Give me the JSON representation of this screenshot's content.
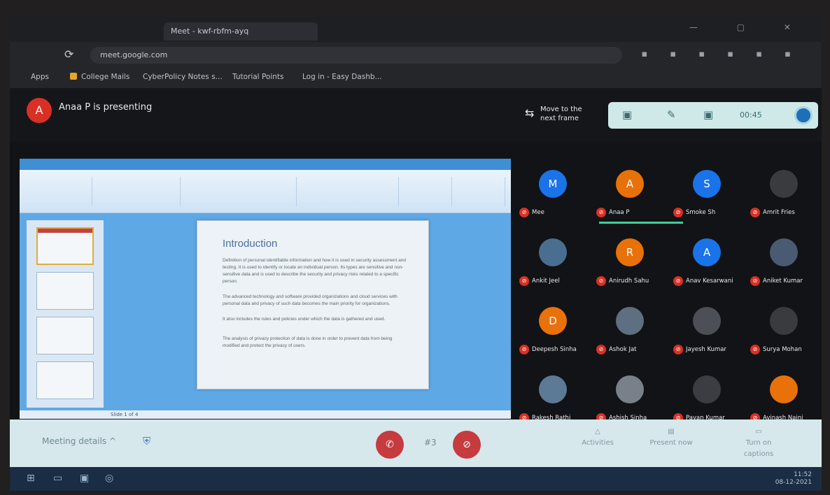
{
  "browser": {
    "tab_title": "Meet - kwf-rbfm-ayq",
    "url": "meet.google.com",
    "bookmarks": [
      "Apps",
      "College Mails",
      "CyberPolicy Notes s...",
      "Tutorial Points",
      "Log in - Easy Dashb..."
    ],
    "window_controls": "— ▢ ✕",
    "extensions": "▪ ▪ ▪ ▪ ▪ ▪"
  },
  "meet": {
    "presenter_initial": "A",
    "presenting_text": "Anaa P is presenting",
    "presenting_sub": "",
    "move_label_1": "Move to the",
    "move_label_2": "next frame",
    "control_icons": [
      "▣",
      "✎",
      "▣",
      "00:45",
      "●"
    ],
    "meeting_details_label": "Meeting details",
    "meeting_details_caret": "^",
    "page_indicator": "#3",
    "bottom_buttons": [
      "Activities",
      "Present now",
      "Turn on captions"
    ]
  },
  "presentation": {
    "slide_title": "Introduction",
    "bullets": [
      "Definition of personal identifiable information and how it is used in security assessment and testing. It is used to identify or locate an individual person. Its types are sensitive and non-sensitive data and is used to describe the security and privacy risks related to a specific person.",
      "The advanced technology and software provided organizations and cloud services with personal data and privacy of such data becomes the main priority for organizations.",
      "It also includes the rules and policies under which the data is gathered and used.",
      "The analysis of privacy protection of data is done in order to prevent data from being modified and protect the privacy of users."
    ],
    "status_text": "Slide 1 of 4"
  },
  "participants": [
    {
      "initial": "M",
      "name": "Mee",
      "color": "#1a73e8"
    },
    {
      "initial": "A",
      "name": "Anaa P",
      "color": "#e8710a"
    },
    {
      "initial": "S",
      "name": "Smoke Sh",
      "color": "#1a73e8"
    },
    {
      "initial": "",
      "name": "Amrit Fries",
      "color": "#3a3b3e"
    },
    {
      "initial": "",
      "name": "Ankit Jeel",
      "color": "#4a6e90"
    },
    {
      "initial": "R",
      "name": "Anirudh Sahu",
      "color": "#e8710a"
    },
    {
      "initial": "A",
      "name": "Anav Kesarwani",
      "color": "#1a73e8"
    },
    {
      "initial": "",
      "name": "Aniket Kumar",
      "color": "#4a5a73"
    },
    {
      "initial": "D",
      "name": "Deepesh Sinha",
      "color": "#e8710a"
    },
    {
      "initial": "",
      "name": "Ashok Jat",
      "color": "#5e6f82"
    },
    {
      "initial": "",
      "name": "Jayesh Kumar",
      "color": "#4c4f55"
    },
    {
      "initial": "",
      "name": "Surya Mohan",
      "color": "#3a3b3e"
    },
    {
      "initial": "",
      "name": "Rakesh Rathi",
      "color": "#5c7a96"
    },
    {
      "initial": "",
      "name": "Ashish Sinha",
      "color": "#7a8089"
    },
    {
      "initial": "",
      "name": "Pavan Kumar",
      "color": "#3c3d42"
    },
    {
      "initial": "",
      "name": "Avinash Naini",
      "color": "#e8710a"
    }
  ],
  "taskbar": {
    "time": "11:52",
    "date": "08-12-2021"
  }
}
